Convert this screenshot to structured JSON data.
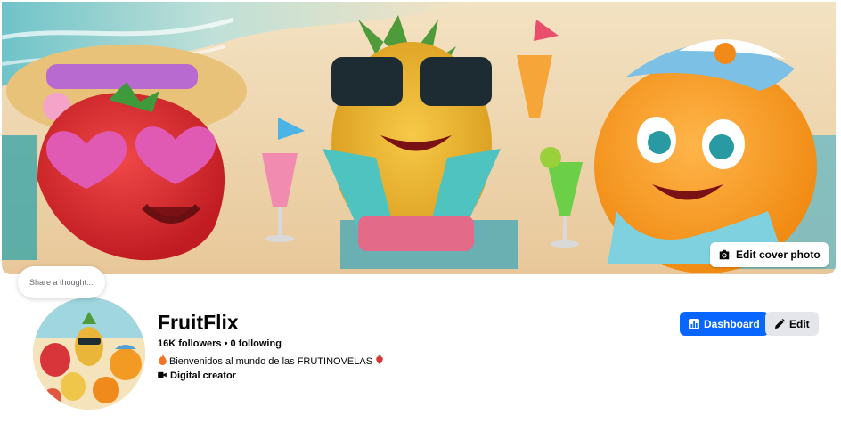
{
  "cover": {
    "edit_label": "Edit cover photo",
    "camera_icon": "camera-icon"
  },
  "thought": {
    "placeholder": "Share a thought..."
  },
  "profile": {
    "name": "FruitFlix",
    "stats": "16K followers • 0 following",
    "bio_text": "Bienvenidos al mundo de las FRUTINOVELAS",
    "bio_icons": [
      "flame-icon",
      "strawberry-icon"
    ],
    "category": "Digital creator",
    "category_icon": "video-camera-icon"
  },
  "actions": {
    "dashboard_label": "Dashboard",
    "dashboard_icon": "bar-chart-icon",
    "edit_label": "Edit",
    "edit_icon": "pencil-icon"
  },
  "colors": {
    "accent": "#0866ff",
    "secondary_button": "#e4e6eb",
    "text": "#050505",
    "muted": "#65676b"
  }
}
